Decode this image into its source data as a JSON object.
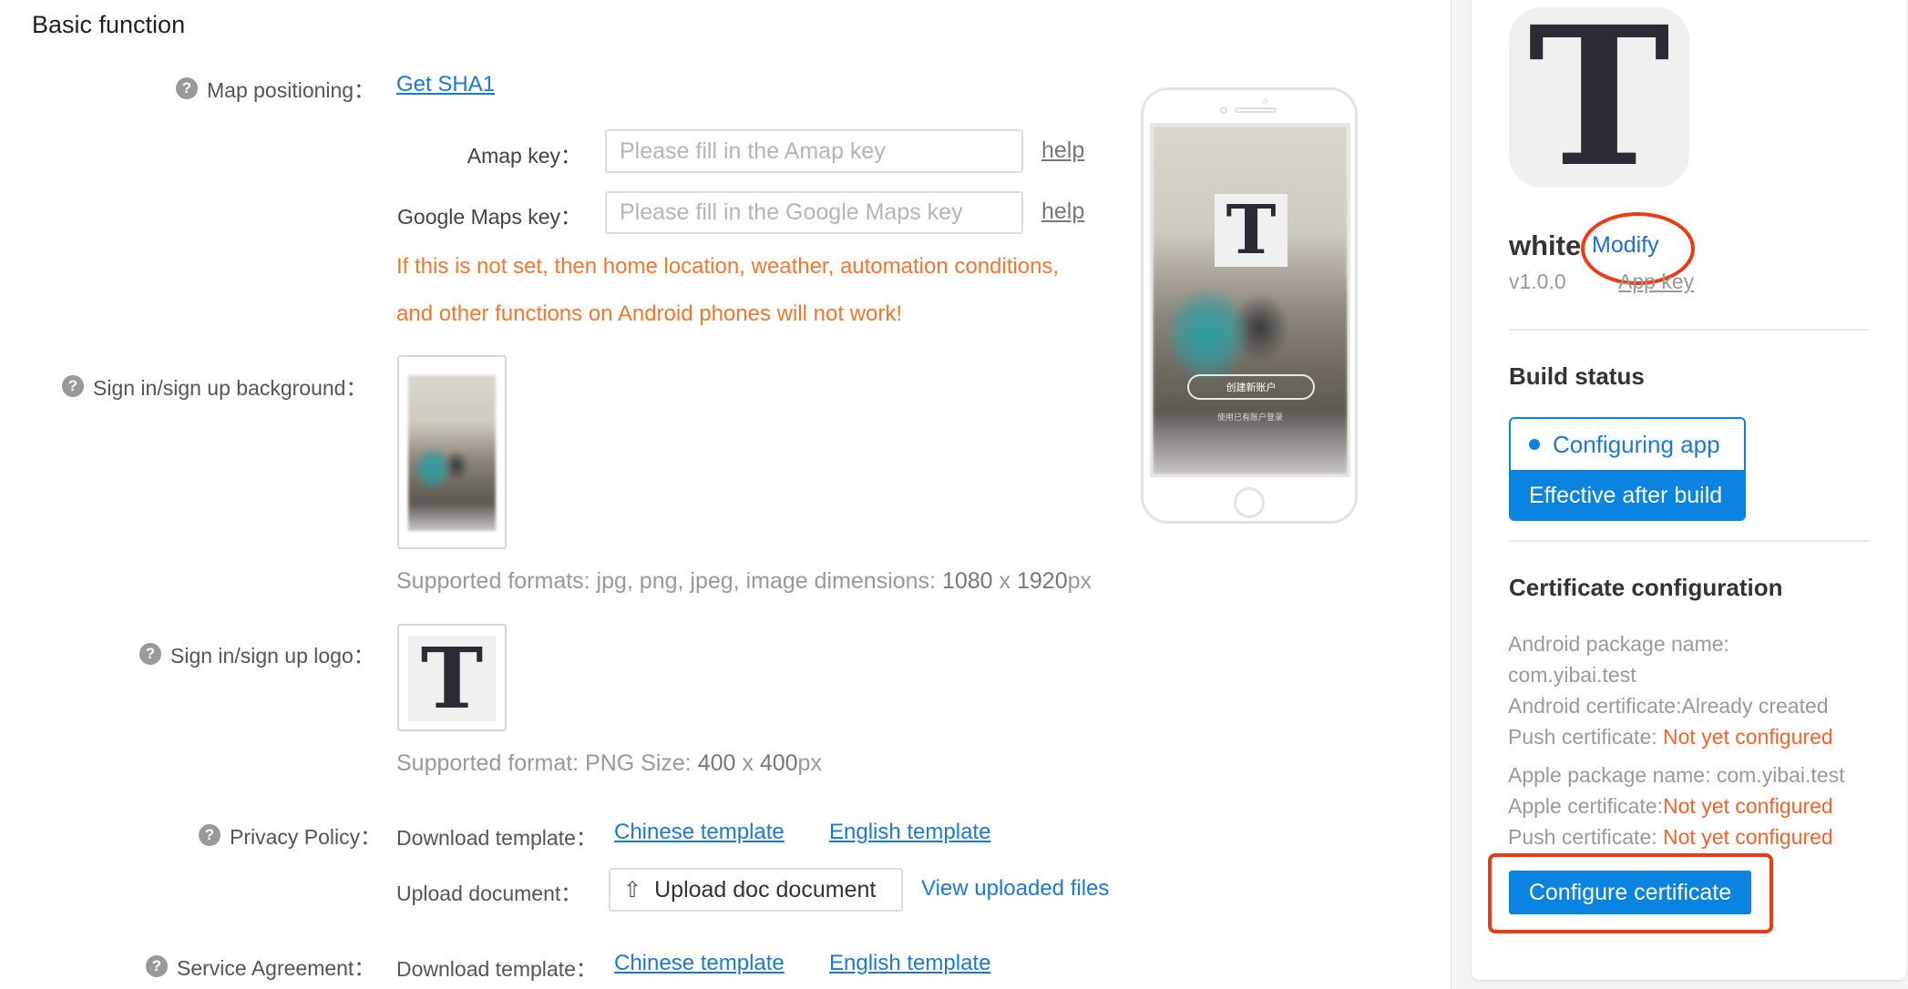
{
  "page": {
    "title": "Basic function"
  },
  "map_positioning": {
    "label": "Map positioning：",
    "link": "Get SHA1",
    "amap": {
      "label": "Amap key：",
      "placeholder": "Please fill in the Amap key",
      "value": "",
      "help": "help"
    },
    "google": {
      "label": "Google Maps key：",
      "placeholder": "Please fill in the Google Maps key",
      "value": "",
      "help": "help"
    },
    "warning_line1": "If this is not set, then home location, weather, automation conditions,",
    "warning_line2": "and other functions on Android phones will not work!"
  },
  "background": {
    "label": "Sign in/sign up background：",
    "hint_prefix": "Supported formats: jpg, png, jpeg, image dimensions: ",
    "hint_w": "1080",
    "hint_x": " x ",
    "hint_h": "1920",
    "hint_unit": "px"
  },
  "logo": {
    "label": "Sign in/sign up logo：",
    "glyph": "T",
    "hint_prefix": "Supported format: PNG Size: ",
    "hint_w": "400",
    "hint_x": " x ",
    "hint_h": "400",
    "hint_unit": "px"
  },
  "privacy": {
    "label": "Privacy Policy：",
    "download_label": "Download template：",
    "chinese_template": "Chinese template",
    "english_template": "English template",
    "upload_label": "Upload document：",
    "upload_button": "Upload doc document",
    "upload_icon": "upload-icon",
    "view_uploaded": "View uploaded files"
  },
  "service": {
    "label": "Service Agreement：",
    "download_label": "Download template：",
    "chinese_template": "Chinese template",
    "english_template": "English template"
  },
  "phone_preview": {
    "logo_glyph": "T",
    "create_account": "创建新账户",
    "login_existing": "使用已有账户登录"
  },
  "sidebar": {
    "app_icon_glyph": "T",
    "app_name": "white",
    "modify": "Modify",
    "version": "v1.0.0",
    "app_key": "App key",
    "build_status": {
      "title": "Build status",
      "state": "Configuring app",
      "note": "Effective after build"
    },
    "certificate": {
      "title": "Certificate configuration",
      "android_pkg_label": "Android package name:",
      "android_pkg_value": "com.yibai.test",
      "android_cert_label": "Android certificate:",
      "android_cert_value": "Already created",
      "android_push_label": "Push certificate: ",
      "android_push_value": "Not yet configured",
      "apple_pkg_label": "Apple package name: ",
      "apple_pkg_value": "com.yibai.test",
      "apple_cert_label": "Apple certificate:",
      "apple_cert_value": "Not yet configured",
      "apple_push_label": "Push certificate: ",
      "apple_push_value": "Not yet configured",
      "configure_button": "Configure certificate"
    }
  },
  "colors": {
    "accent": "#0a84e0",
    "link": "#1a7ad9",
    "warning": "#f6762e",
    "annotation_red": "#f03a12"
  }
}
